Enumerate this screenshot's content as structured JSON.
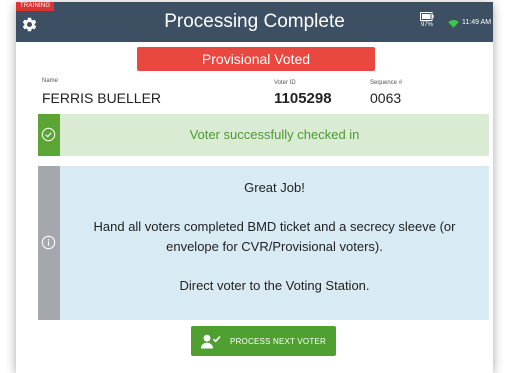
{
  "header": {
    "training_badge": "TRAINING",
    "title": "Processing Complete",
    "battery_percent": "97%",
    "time": "11:49 AM",
    "settings_icon": "gear-icon",
    "battery_icon": "battery-icon",
    "wifi_icon": "wifi-icon",
    "background_color": "#3c4f63"
  },
  "status_banner": {
    "text": "Provisional Voted",
    "color": "#e8483f"
  },
  "voter": {
    "name_label": "Name",
    "name": "FERRIS BUELLER",
    "voter_id_label": "Voter ID",
    "voter_id": "1105298",
    "sequence_label": "Sequence #",
    "sequence": "0063"
  },
  "success": {
    "text": "Voter successfully checked in",
    "icon": "check-circle-icon",
    "accent_color": "#5aa534",
    "background_color": "#d9ecd3"
  },
  "info": {
    "icon": "info-circle-icon",
    "line1": "Great Job!",
    "line2": "Hand all voters completed BMD ticket and a secrecy sleeve (or",
    "line3": "envelope for CVR/Provisional voters).",
    "line4": "Direct voter to the Voting Station.",
    "background_color": "#d8eaf3"
  },
  "actions": {
    "process_next_label": "PROCESS NEXT VOTER",
    "process_next_icon": "user-check-icon",
    "button_color": "#4fa030"
  }
}
